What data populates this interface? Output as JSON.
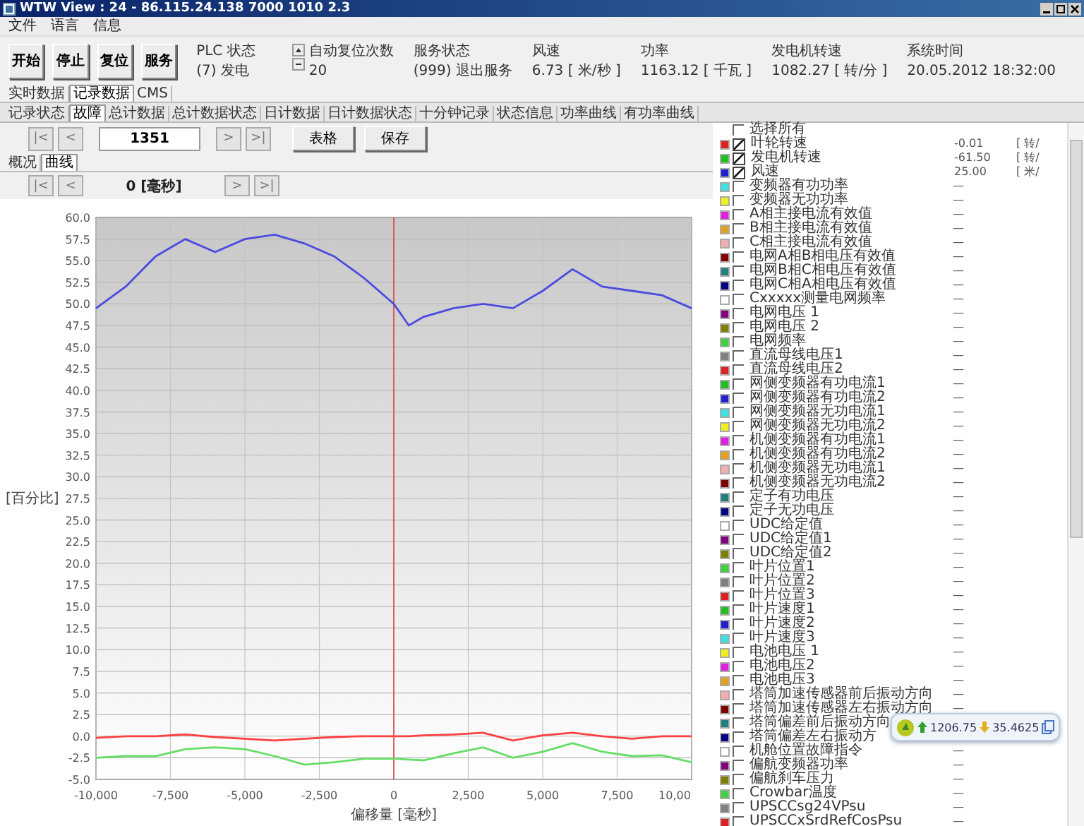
{
  "window": {
    "title": "WTW View : 24 - 86.115.24.138 7000 1010 2.3"
  },
  "menu": [
    "文件",
    "语言",
    "信息"
  ],
  "commands": [
    "开始",
    "停止",
    "复位",
    "服务"
  ],
  "status": [
    {
      "label": "PLC 状态",
      "value": "(7) 发电"
    },
    {
      "label": "自动复位次数",
      "value": "20"
    },
    {
      "label": "服务状态",
      "value": "(999) 退出服务"
    },
    {
      "label": "风速",
      "value": "6.73 [ 米/秒 ]"
    },
    {
      "label": "功率",
      "value": "1163.12 [ 千瓦 ]"
    },
    {
      "label": "发电机转速",
      "value": "1082.27 [ 转/分 ]"
    },
    {
      "label": "系统时间",
      "value": "20.05.2012 18:32:00"
    }
  ],
  "tabs": [
    {
      "label": "实时数据",
      "selected": false
    },
    {
      "label": "记录数据",
      "selected": true
    },
    {
      "label": "CMS",
      "selected": false
    }
  ],
  "record_tabs": [
    {
      "label": "记录状态",
      "selected": false
    },
    {
      "label": "故障",
      "selected": true
    },
    {
      "label": "总计数据",
      "selected": false
    },
    {
      "label": "总计数据状态",
      "selected": false
    },
    {
      "label": "日计数据",
      "selected": false
    },
    {
      "label": "日计数据状态",
      "selected": false
    },
    {
      "label": "十分钟记录",
      "selected": false
    },
    {
      "label": "状态信息",
      "selected": false
    },
    {
      "label": "功率曲线",
      "selected": false
    },
    {
      "label": "有功率曲线",
      "selected": false
    }
  ],
  "record_nav": {
    "first": "|<",
    "prev": "<",
    "value": "1351",
    "next": ">",
    "last": ">|",
    "buttons": [
      "表格",
      "保存"
    ]
  },
  "view_tabs": [
    {
      "label": "概况",
      "selected": false
    },
    {
      "label": "曲线",
      "selected": true
    }
  ],
  "chart_nav": {
    "first": "|<",
    "prev": "<",
    "position": "0 [毫秒]",
    "next": ">",
    "last": ">|"
  },
  "chart_data": {
    "type": "line",
    "xlabel": "偏移量 [毫秒]",
    "ylabel": "[百分比]",
    "x": [
      -10000,
      -9000,
      -8000,
      -7000,
      -6000,
      -5000,
      -4000,
      -3000,
      -2000,
      -1000,
      0,
      500,
      1000,
      2000,
      3000,
      4000,
      5000,
      6000,
      7000,
      8000,
      9000,
      10000
    ],
    "series": [
      {
        "color": "#4b4be0",
        "values": [
          49.5,
          52,
          55.5,
          57.5,
          56,
          57.5,
          58,
          57,
          55.5,
          53,
          50,
          47.5,
          48.5,
          49.5,
          50,
          49.5,
          51.5,
          54,
          52,
          51.5,
          51,
          49.5
        ]
      },
      {
        "color": "#ff4040",
        "values": [
          -0.2,
          0,
          0,
          0.2,
          -0.1,
          -0.3,
          -0.5,
          -0.3,
          -0.1,
          0,
          0,
          0,
          0.1,
          0.2,
          0.4,
          -0.5,
          0.1,
          0.4,
          0,
          -0.3,
          0,
          0
        ]
      },
      {
        "color": "#66dd66",
        "values": [
          -2.5,
          -2.3,
          -2.3,
          -1.5,
          -1.3,
          -1.5,
          -2.3,
          -3.3,
          -3,
          -2.6,
          -2.6,
          -2.7,
          -2.8,
          -2,
          -1.3,
          -2.5,
          -1.8,
          -0.8,
          -1.8,
          -2.3,
          -2.2,
          -3
        ]
      }
    ],
    "xlim": [
      -10000,
      10000
    ],
    "ylim": [
      -5,
      60
    ],
    "grid": true,
    "ref_lines": [
      {
        "axis": "x",
        "value": 0,
        "color": "#e04040"
      }
    ],
    "xticks": [
      {
        "value": -10000,
        "label": "-10,000"
      },
      {
        "value": -7500,
        "label": "-7,500"
      },
      {
        "value": -5000,
        "label": "-5,000"
      },
      {
        "value": -2500,
        "label": "-2,500"
      },
      {
        "value": 0,
        "label": "0"
      },
      {
        "value": 2500,
        "label": "2,500"
      },
      {
        "value": 5000,
        "label": "5,000"
      },
      {
        "value": 7500,
        "label": "7,500"
      }
    ],
    "yticks": [
      {
        "value": 60,
        "label": "60.0"
      },
      {
        "value": 57.5,
        "label": "57.5"
      },
      {
        "value": 55,
        "label": "55.0"
      },
      {
        "value": 52.5,
        "label": "52.5"
      },
      {
        "value": 50,
        "label": "50.0"
      },
      {
        "value": 47.5,
        "label": "47.5"
      },
      {
        "value": 45,
        "label": "45.0"
      },
      {
        "value": 42.5,
        "label": "42.5"
      },
      {
        "value": 40,
        "label": "40.0"
      },
      {
        "value": 37.5,
        "label": "37.5"
      },
      {
        "value": 35,
        "label": "35.0"
      },
      {
        "value": 32.5,
        "label": "32.5"
      },
      {
        "value": 30,
        "label": "30.0"
      },
      {
        "value": 27.5,
        "label": "27.5"
      },
      {
        "value": 25,
        "label": "25.0"
      },
      {
        "value": 22.5,
        "label": "22.5"
      },
      {
        "value": 20,
        "label": "20.0"
      },
      {
        "value": 17.5,
        "label": "17.5"
      },
      {
        "value": 15,
        "label": "15.0"
      },
      {
        "value": 12.5,
        "label": "12.5"
      },
      {
        "value": 10,
        "label": "10.0"
      },
      {
        "value": 7.5,
        "label": "7.5"
      },
      {
        "value": 5,
        "label": "5.0"
      },
      {
        "value": 2.5,
        "label": "2.5"
      },
      {
        "value": 0,
        "label": "0.0"
      },
      {
        "value": -2.5,
        "label": "-2.5"
      },
      {
        "value": -5,
        "label": "-5.0"
      }
    ]
  },
  "chart_cut_tick_label": "10,00",
  "legend": {
    "select_all": {
      "label": "选择所有",
      "checked": false
    },
    "items": [
      {
        "name": "叶轮转速",
        "color": "#e02020",
        "checked": true,
        "value": "-0.01",
        "unit": "[ 转/"
      },
      {
        "name": "发电机转速",
        "color": "#20c020",
        "checked": true,
        "value": "-61.50",
        "unit": "[ 转/"
      },
      {
        "name": "风速",
        "color": "#2020d0",
        "checked": true,
        "value": "25.00",
        "unit": "[ 米/"
      },
      {
        "name": "变频器有功功率",
        "color": "#40e0e0",
        "checked": false,
        "value": "—"
      },
      {
        "name": "变频器无功功率",
        "color": "#f0f020",
        "checked": false,
        "value": "—"
      },
      {
        "name": "A相主接电流有效值",
        "color": "#e020e0",
        "checked": false,
        "value": "—"
      },
      {
        "name": "B相主接电流有效值",
        "color": "#e0a020",
        "checked": false,
        "value": "—"
      },
      {
        "name": "C相主接电流有效值",
        "color": "#f0b0b0",
        "checked": false,
        "value": "—"
      },
      {
        "name": "电网A相B相电压有效值",
        "color": "#800000",
        "checked": false,
        "value": "—"
      },
      {
        "name": "电网B相C相电压有效值",
        "color": "#208080",
        "checked": false,
        "value": "—"
      },
      {
        "name": "电网C相A相电压有效值",
        "color": "#000080",
        "checked": false,
        "value": "—"
      },
      {
        "name": "Cxxxxx测量电网频率",
        "color": "#ffffff",
        "checked": false,
        "value": "—"
      },
      {
        "name": "电网电压 1",
        "color": "#800080",
        "checked": false,
        "value": "—"
      },
      {
        "name": "电网电压 2",
        "color": "#808000",
        "checked": false,
        "value": "—"
      },
      {
        "name": "电网频率",
        "color": "#40d040",
        "checked": false,
        "value": "—"
      },
      {
        "name": "直流母线电压1",
        "color": "#808080",
        "checked": false,
        "value": "—"
      },
      {
        "name": "直流母线电压2",
        "color": "#e02020",
        "checked": false,
        "value": "—"
      },
      {
        "name": "网侧变频器有功电流1",
        "color": "#20c020",
        "checked": false,
        "value": "—"
      },
      {
        "name": "网侧变频器有功电流2",
        "color": "#2020d0",
        "checked": false,
        "value": "—"
      },
      {
        "name": "网侧变频器无功电流1",
        "color": "#40e0e0",
        "checked": false,
        "value": "—"
      },
      {
        "name": "网侧变频器无功电流2",
        "color": "#f0f020",
        "checked": false,
        "value": "—"
      },
      {
        "name": "机侧变频器有功电流1",
        "color": "#e020e0",
        "checked": false,
        "value": "—"
      },
      {
        "name": "机侧变频器有功电流2",
        "color": "#e0a020",
        "checked": false,
        "value": "—"
      },
      {
        "name": "机侧变频器无功电流1",
        "color": "#f0b0b0",
        "checked": false,
        "value": "—"
      },
      {
        "name": "机侧变频器无功电流2",
        "color": "#800000",
        "checked": false,
        "value": "—"
      },
      {
        "name": "定子有功电压",
        "color": "#208080",
        "checked": false,
        "value": "—"
      },
      {
        "name": "定子无功电压",
        "color": "#000080",
        "checked": false,
        "value": "—"
      },
      {
        "name": "UDC给定值",
        "color": "#ffffff",
        "checked": false,
        "value": "—"
      },
      {
        "name": "UDC给定值1",
        "color": "#800080",
        "checked": false,
        "value": "—"
      },
      {
        "name": "UDC给定值2",
        "color": "#808000",
        "checked": false,
        "value": "—"
      },
      {
        "name": "叶片位置1",
        "color": "#40d040",
        "checked": false,
        "value": "—"
      },
      {
        "name": "叶片位置2",
        "color": "#808080",
        "checked": false,
        "value": "—"
      },
      {
        "name": "叶片位置3",
        "color": "#e02020",
        "checked": false,
        "value": "—"
      },
      {
        "name": "叶片速度1",
        "color": "#20c020",
        "checked": false,
        "value": "—"
      },
      {
        "name": "叶片速度2",
        "color": "#2020d0",
        "checked": false,
        "value": "—"
      },
      {
        "name": "叶片速度3",
        "color": "#40e0e0",
        "checked": false,
        "value": "—"
      },
      {
        "name": "电池电压 1",
        "color": "#f0f020",
        "checked": false,
        "value": "—"
      },
      {
        "name": "电池电压2",
        "color": "#e020e0",
        "checked": false,
        "value": "—"
      },
      {
        "name": "电池电压3",
        "color": "#e0a020",
        "checked": false,
        "value": "—"
      },
      {
        "name": "塔筒加速传感器前后振动方向",
        "color": "#f0b0b0",
        "checked": false,
        "value": "—"
      },
      {
        "name": "塔筒加速传感器左右振动方向",
        "color": "#800000",
        "checked": false,
        "value": "—"
      },
      {
        "name": "塔筒偏差前后振动方向",
        "color": "#208080",
        "checked": false
      },
      {
        "name": "塔筒偏差左右振动方",
        "color": "#000080",
        "checked": false
      },
      {
        "name": "机舱位置故障指令",
        "color": "#ffffff",
        "checked": false,
        "value": "—"
      },
      {
        "name": "偏航变频器功率",
        "color": "#800080",
        "checked": false,
        "value": "—"
      },
      {
        "name": "偏航刹车压力",
        "color": "#808000",
        "checked": false,
        "value": "—"
      },
      {
        "name": "Crowbar温度",
        "color": "#40d040",
        "checked": false,
        "value": "—"
      },
      {
        "name": "UPSCCsg24VPsu",
        "color": "#808080",
        "checked": false,
        "value": "—"
      },
      {
        "name": "UPSCCxSrdRefCosPsu",
        "color": "#e02020",
        "checked": false,
        "value": "—"
      }
    ]
  },
  "floating_widget": {
    "upload": "1206.75",
    "download": "35.4625"
  }
}
